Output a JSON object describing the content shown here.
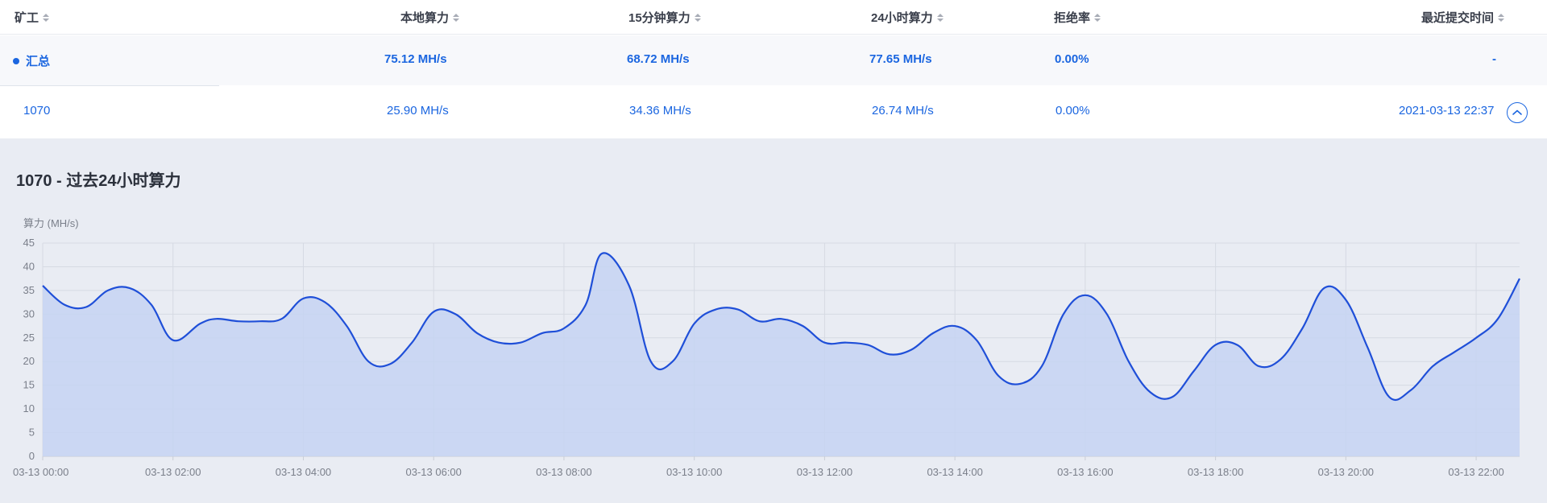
{
  "table": {
    "headers": {
      "miner": "矿工",
      "local_hashrate": "本地算力",
      "hashrate_15m": "15分钟算力",
      "hashrate_24h": "24小时算力",
      "reject_rate": "拒绝率",
      "last_submit": "最近提交时间"
    },
    "summary_row": {
      "miner": "汇总",
      "local_hashrate": "75.12 MH/s",
      "hashrate_15m": "68.72 MH/s",
      "hashrate_24h": "77.65 MH/s",
      "reject_rate": "0.00%",
      "last_submit": "-"
    },
    "rows": [
      {
        "miner": "1070",
        "local_hashrate": "25.90 MH/s",
        "hashrate_15m": "34.36 MH/s",
        "hashrate_24h": "26.74 MH/s",
        "reject_rate": "0.00%",
        "last_submit": "2021-03-13 22:37"
      }
    ]
  },
  "colors": {
    "accent": "#1b66e0",
    "line": "#1f4fd8",
    "area": "#c6d4f2",
    "panel": "#e9ecf3"
  },
  "chart_data": {
    "type": "area",
    "title": "1070 - 过去24小时算力",
    "ylabel": "算力 (MH/s)",
    "xlabel": "",
    "ylim": [
      0,
      45
    ],
    "yticks": [
      0,
      5,
      10,
      15,
      20,
      25,
      30,
      35,
      40,
      45
    ],
    "xlim": [
      "03-13 00:00",
      "03-13 22:40"
    ],
    "x_tick_labels": [
      "03-13 00:00",
      "03-13 02:00",
      "03-13 04:00",
      "03-13 06:00",
      "03-13 08:00",
      "03-13 10:00",
      "03-13 12:00",
      "03-13 14:00",
      "03-13 16:00",
      "03-13 18:00",
      "03-13 20:00",
      "03-13 22:00"
    ],
    "grid": true,
    "series": [
      {
        "x": [
          "03-13 00:00",
          "03-13 00:20",
          "03-13 00:40",
          "03-13 01:00",
          "03-13 01:20",
          "03-13 01:40",
          "03-13 02:00",
          "03-13 02:25",
          "03-13 02:40",
          "03-13 03:00",
          "03-13 03:20",
          "03-13 03:40",
          "03-13 04:00",
          "03-13 04:20",
          "03-13 04:40",
          "03-13 05:00",
          "03-13 05:20",
          "03-13 05:40",
          "03-13 06:00",
          "03-13 06:20",
          "03-13 06:40",
          "03-13 07:00",
          "03-13 07:20",
          "03-13 07:40",
          "03-13 08:00",
          "03-13 08:20",
          "03-13 08:35",
          "03-13 09:00",
          "03-13 09:20",
          "03-13 09:40",
          "03-13 10:00",
          "03-13 10:20",
          "03-13 10:40",
          "03-13 11:00",
          "03-13 11:20",
          "03-13 11:40",
          "03-13 12:00",
          "03-13 12:20",
          "03-13 12:40",
          "03-13 13:00",
          "03-13 13:20",
          "03-13 13:40",
          "03-13 14:00",
          "03-13 14:20",
          "03-13 14:40",
          "03-13 15:00",
          "03-13 15:20",
          "03-13 15:40",
          "03-13 16:00",
          "03-13 16:20",
          "03-13 16:40",
          "03-13 17:00",
          "03-13 17:20",
          "03-13 17:40",
          "03-13 18:00",
          "03-13 18:20",
          "03-13 18:40",
          "03-13 19:00",
          "03-13 19:20",
          "03-13 19:40",
          "03-13 20:00",
          "03-13 20:20",
          "03-13 20:40",
          "03-13 21:00",
          "03-13 21:20",
          "03-13 21:40",
          "03-13 22:00",
          "03-13 22:20",
          "03-13 22:40"
        ],
        "values": [
          36,
          32,
          31.5,
          35,
          35.5,
          32,
          24.5,
          28,
          29,
          28.5,
          28.5,
          29,
          33.3,
          32.5,
          27.5,
          20,
          19.5,
          24,
          30.5,
          30,
          26,
          24,
          24,
          26,
          27,
          32,
          42.8,
          36,
          20,
          20,
          28,
          31,
          31,
          28.5,
          29,
          27.5,
          24,
          24,
          23.5,
          21.5,
          22.5,
          26,
          27.5,
          24.5,
          17,
          15.3,
          19,
          30,
          34,
          30,
          20,
          13.5,
          12.5,
          18,
          23.5,
          23.5,
          19,
          20.5,
          27,
          35.5,
          33,
          23,
          12.5,
          14,
          19,
          22,
          25,
          29,
          37.5
        ]
      }
    ]
  }
}
